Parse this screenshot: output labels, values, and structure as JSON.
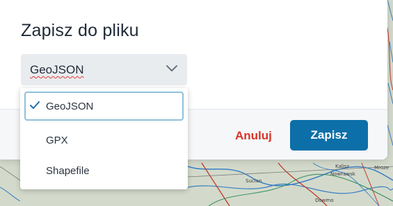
{
  "dialog": {
    "title": "Zapisz do pliku",
    "cancel_label": "Anuluj",
    "save_label": "Zapisz"
  },
  "format_select": {
    "value": "GeoJSON",
    "options": [
      {
        "label": "GeoJSON",
        "selected": true
      },
      {
        "label": "GPX",
        "selected": false
      },
      {
        "label": "Shapefile",
        "selected": false
      }
    ]
  },
  "map": {
    "labels": [
      "Kalisz",
      "Mroze",
      "Sucian",
      "Nowrawsk",
      "Dowmo"
    ]
  },
  "colors": {
    "primary": "#0d6fa8",
    "danger": "#d9342b",
    "focus_ring": "#8fc0dd"
  }
}
